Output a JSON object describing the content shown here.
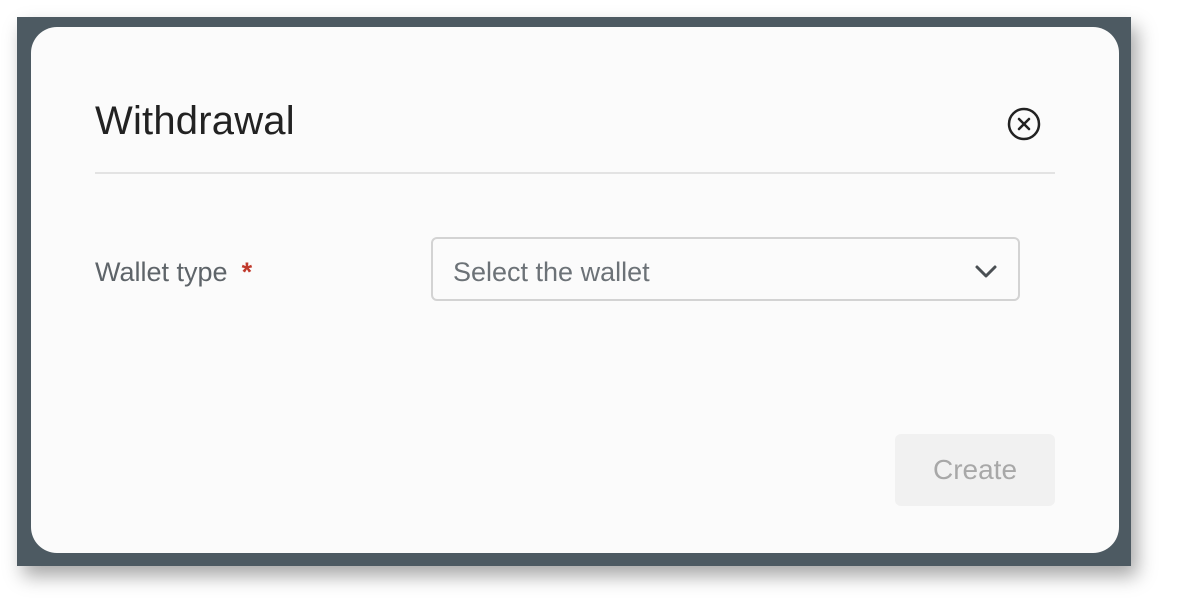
{
  "modal": {
    "title": "Withdrawal",
    "close_icon": "close-circle-icon"
  },
  "form": {
    "wallet_type": {
      "label": "Wallet type",
      "required_mark": "*",
      "placeholder": "Select the wallet",
      "icon": "chevron-down-icon"
    }
  },
  "actions": {
    "create_label": "Create",
    "create_disabled": true
  },
  "colors": {
    "overlay": "#4d5a62",
    "modal_bg": "#fbfbfb",
    "required": "#c0392b",
    "disabled_bg": "#f1f1f1",
    "disabled_text": "#a8a8a8"
  }
}
